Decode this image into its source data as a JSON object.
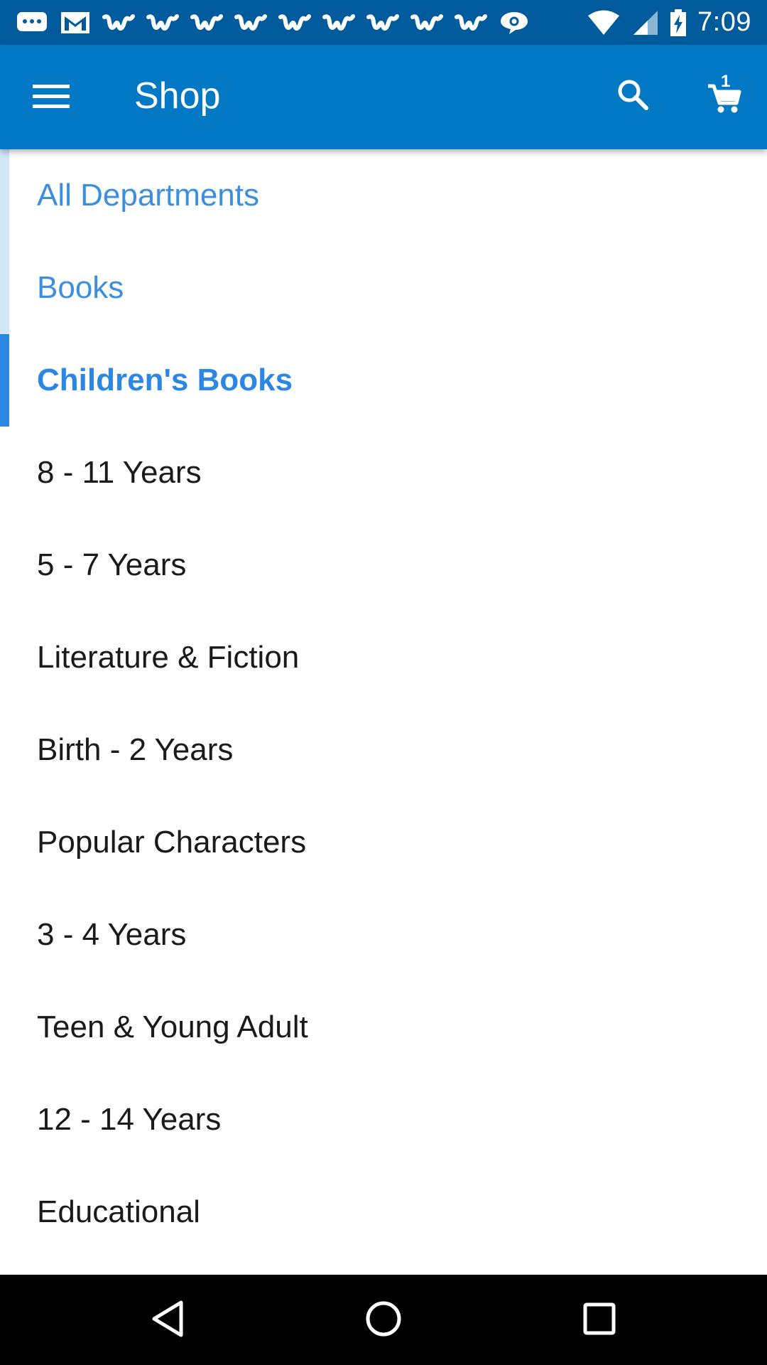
{
  "status_bar": {
    "time": "7:09",
    "notification_icons": [
      "message-icon",
      "gmail-icon",
      "w-app-icon",
      "w-app-icon",
      "w-app-icon",
      "w-app-icon",
      "w-app-icon",
      "w-app-icon",
      "w-app-icon",
      "w-app-icon",
      "w-app-icon",
      "chat-icon"
    ],
    "system_icons": [
      "wifi-icon",
      "signal-icon",
      "battery-charging-icon"
    ]
  },
  "app_bar": {
    "title": "Shop",
    "cart_count": "1",
    "color": "#0379c6"
  },
  "categories": {
    "breadcrumbs": [
      {
        "label": "All Departments"
      },
      {
        "label": "Books"
      }
    ],
    "current": {
      "label": "Children's Books"
    },
    "subcategories": [
      {
        "label": "8 - 11 Years"
      },
      {
        "label": "5 - 7 Years"
      },
      {
        "label": "Literature & Fiction"
      },
      {
        "label": "Birth - 2 Years"
      },
      {
        "label": "Popular Characters"
      },
      {
        "label": "3 - 4 Years"
      },
      {
        "label": "Teen & Young Adult"
      },
      {
        "label": "12 - 14 Years"
      },
      {
        "label": "Educational"
      }
    ]
  },
  "nav_bar": {
    "buttons": [
      "back-icon",
      "home-icon",
      "recents-icon"
    ]
  }
}
